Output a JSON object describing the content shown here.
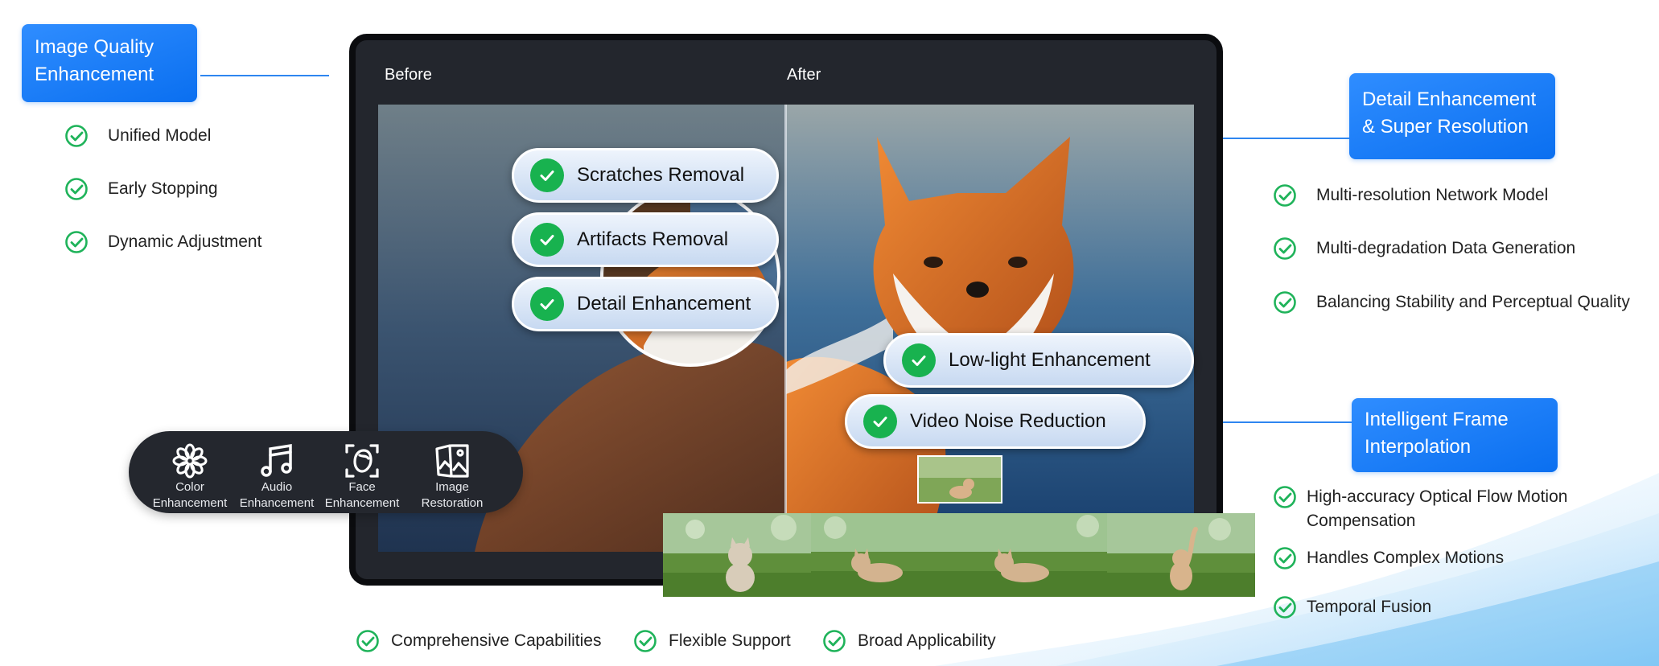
{
  "left_panel": {
    "title_line1": "Image Quality",
    "title_line2": "Enhancement",
    "items": [
      "Unified Model",
      "Early Stopping",
      "Dynamic Adjustment"
    ]
  },
  "device": {
    "before_label": "Before",
    "after_label": "After"
  },
  "pills": [
    "Scratches Removal",
    "Artifacts Removal",
    "Detail Enhancement",
    "Low-light Enhancement",
    "Video Noise Reduction"
  ],
  "toolbar": {
    "tools": [
      {
        "line1": "Color",
        "line2": "Enhancement",
        "icon": "flower-icon"
      },
      {
        "line1": "Audio",
        "line2": "Enhancement",
        "icon": "music-note-icon"
      },
      {
        "line1": "Face",
        "line2": "Enhancement",
        "icon": "face-scan-icon"
      },
      {
        "line1": "Image",
        "line2": "Restoration",
        "icon": "image-restore-icon"
      }
    ]
  },
  "right_top": {
    "title_line1": "Detail Enhancement",
    "title_line2": "& Super Resolution",
    "items": [
      "Multi-resolution Network Model",
      "Multi-degradation Data Generation",
      "Balancing Stability and Perceptual Quality"
    ]
  },
  "right_bottom": {
    "title_line1": "Intelligent Frame",
    "title_line2": "Interpolation",
    "items": [
      "High-accuracy Optical Flow Motion",
      "Compensation",
      "Handles Complex Motions",
      "Temporal Fusion"
    ]
  },
  "bottom": {
    "items": [
      "Comprehensive Capabilities",
      "Flexible Support",
      "Broad Applicability"
    ]
  },
  "colors": {
    "accent_blue": "#0a6ff0",
    "check_green": "#18b24f",
    "outline_check": "#1fb35a",
    "device_dark": "#23262d"
  }
}
